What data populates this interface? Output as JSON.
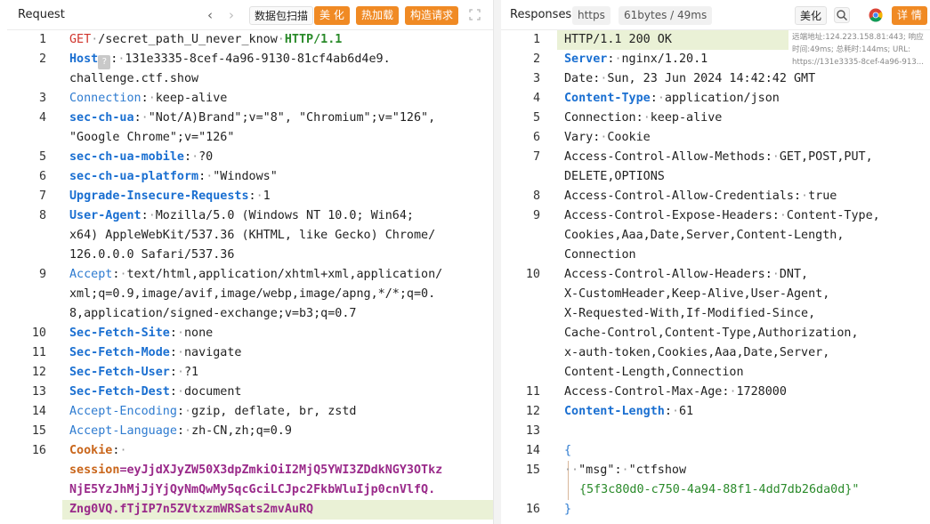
{
  "request": {
    "title": "Request",
    "nav_back": "‹",
    "nav_forward": "›",
    "btn_capture": "数据包扫描",
    "btn_beautify": "美 化",
    "btn_hot_load": "热加载",
    "btn_construct": "构造请求",
    "lines": [
      {
        "n": "1"
      },
      {
        "n": "2"
      },
      {
        "n": "3"
      },
      {
        "n": "4"
      },
      {
        "n": "5"
      },
      {
        "n": "6"
      },
      {
        "n": "7"
      },
      {
        "n": "8"
      },
      {
        "n": "9"
      },
      {
        "n": "10"
      },
      {
        "n": "11"
      },
      {
        "n": "12"
      },
      {
        "n": "13"
      },
      {
        "n": "14"
      },
      {
        "n": "15"
      },
      {
        "n": "16"
      }
    ],
    "method": "GET",
    "path": "/secret_path_U_never_know",
    "version": "HTTP/1.1",
    "host_key": "Host",
    "host_icon": "?",
    "host_value_1": "131e3335-8cef-4a96-9130-81cf4ab6d4e9.",
    "host_value_2": "challenge.ctf.show",
    "connection_key": "Connection",
    "connection_value": "keep-alive",
    "secchua_key": "sec-ch-ua",
    "secchua_value_1": "\"Not/A)Brand\";v=\"8\", \"Chromium\";v=\"126\", ",
    "secchua_value_2": "\"Google Chrome\";v=\"126\"",
    "mobile_key": "sec-ch-ua-mobile",
    "mobile_value": "?0",
    "platform_key": "sec-ch-ua-platform",
    "platform_value": "\"Windows\"",
    "upgrade_key": "Upgrade-Insecure-Requests",
    "upgrade_value": "1",
    "ua_key": "User-Agent",
    "ua_value_1": "Mozilla/5.0 (Windows NT 10.0; Win64;",
    "ua_value_2": "x64) AppleWebKit/537.36 (KHTML, like Gecko) Chrome/",
    "ua_value_3": "126.0.0.0 Safari/537.36",
    "accept_key": "Accept",
    "accept_value_1": "text/html,application/xhtml+xml,application/",
    "accept_value_2": "xml;q=0.9,image/avif,image/webp,image/apng,*/*;q=0.",
    "accept_value_3": "8,application/signed-exchange;v=b3;q=0.7",
    "site_key": "Sec-Fetch-Site",
    "site_value": "none",
    "mode_key": "Sec-Fetch-Mode",
    "mode_value": "navigate",
    "user_key": "Sec-Fetch-User",
    "user_value": "?1",
    "dest_key": "Sec-Fetch-Dest",
    "dest_value": "document",
    "encoding_key": "Accept-Encoding",
    "encoding_value": "gzip, deflate, br, zstd",
    "language_key": "Accept-Language",
    "language_value": "zh-CN,zh;q=0.9",
    "cookie_key": "Cookie",
    "session_key": "session",
    "session_value_1": "eyJjdXJyZW50X3dpZmkiOiI2MjQ5YWI3ZDdkNGY3OTkz",
    "session_value_2": "NjE5YzJhMjJjYjQyNmQwMy5qcGciLCJpc2FkbWluIjp0cnVlfQ.",
    "session_value_3": "Zng0VQ.fTjIP7n5ZVtxzmWRSats2mvAuRQ"
  },
  "response": {
    "title": "Responses",
    "tag_protocol": "https",
    "tag_size": "61bytes / 49ms",
    "btn_beautify": "美化",
    "btn_detail": "详 情",
    "tooltip": "远端地址:124.223.158.81:443; 响应时间:49ms; 总耗时:144ms; URL: https://131e3335-8cef-4a96-913...",
    "lines": [
      {
        "n": "1"
      },
      {
        "n": "2"
      },
      {
        "n": "3"
      },
      {
        "n": "4"
      },
      {
        "n": "5"
      },
      {
        "n": "6"
      },
      {
        "n": "7"
      },
      {
        "n": "8"
      },
      {
        "n": "9"
      },
      {
        "n": "10"
      },
      {
        "n": "11"
      },
      {
        "n": "12"
      },
      {
        "n": "13"
      },
      {
        "n": "14"
      },
      {
        "n": "15"
      },
      {
        "n": "16"
      }
    ],
    "status": "HTTP/1.1 200 OK",
    "server_key": "Server",
    "server_value": "nginx/1.20.1",
    "date_key": "Date",
    "date_value": "Sun, 23 Jun 2024 14:42:42 GMT",
    "ctype_key": "Content-Type",
    "ctype_value": "application/json",
    "conn_key": "Connection",
    "conn_value": "keep-alive",
    "vary_key": "Vary",
    "vary_value": "Cookie",
    "acam_key": "Access-Control-Allow-Methods",
    "acam_value_1": "GET,POST,PUT,",
    "acam_value_2": "DELETE,OPTIONS",
    "acac_key": "Access-Control-Allow-Credentials",
    "acac_value": "true",
    "aceh_key": "Access-Control-Expose-Headers",
    "aceh_value_1": "Content-Type,",
    "aceh_value_2": "Cookies,Aaa,Date,Server,Content-Length,",
    "aceh_value_3": "Connection",
    "acah_key": "Access-Control-Allow-Headers",
    "acah_value_1": "DNT,",
    "acah_value_2": "X-CustomHeader,Keep-Alive,User-Agent,",
    "acah_value_3": "X-Requested-With,If-Modified-Since,",
    "acah_value_4": "Cache-Control,Content-Type,Authorization,",
    "acah_value_5": "x-auth-token,Cookies,Aaa,Date,Server,",
    "acah_value_6": "Content-Length,Connection",
    "acma_key": "Access-Control-Max-Age",
    "acma_value": "1728000",
    "clen_key": "Content-Length",
    "clen_value": "61",
    "brace_open": "{",
    "msg_key": "\"msg\"",
    "msg_value_1": "\"ctfshow",
    "msg_value_2": "{5f3c80d0-c750-4a94-88f1-4dd7db26da0d}\"",
    "brace_close": "}"
  }
}
